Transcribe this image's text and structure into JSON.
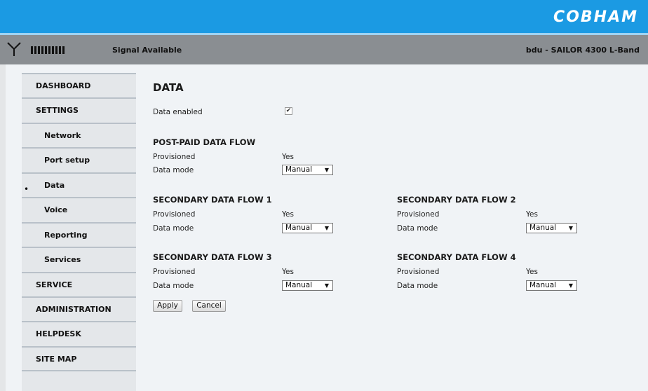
{
  "brand": {
    "logo": "COBHAM"
  },
  "status": {
    "signal_text": "Signal Available",
    "device_text": "bdu - SAILOR 4300 L-Band"
  },
  "sidebar": {
    "items": [
      {
        "label": "DASHBOARD"
      },
      {
        "label": "SETTINGS"
      },
      {
        "label": "Network"
      },
      {
        "label": "Port setup"
      },
      {
        "label": "Data",
        "active": true
      },
      {
        "label": "Voice"
      },
      {
        "label": "Reporting"
      },
      {
        "label": "Services"
      },
      {
        "label": "SERVICE"
      },
      {
        "label": "ADMINISTRATION"
      },
      {
        "label": "HELPDESK"
      },
      {
        "label": "SITE MAP"
      }
    ],
    "active_marker": "•"
  },
  "page": {
    "title": "DATA",
    "data_enabled_label": "Data enabled",
    "data_enabled_checked": true,
    "post_paid": {
      "title": "POST-PAID DATA FLOW",
      "provisioned_label": "Provisioned",
      "provisioned_value": "Yes",
      "mode_label": "Data mode",
      "mode_value": "Manual"
    },
    "secondary1": {
      "title": "SECONDARY DATA FLOW 1",
      "provisioned_label": "Provisioned",
      "provisioned_value": "Yes",
      "mode_label": "Data mode",
      "mode_value": "Manual"
    },
    "secondary2": {
      "title": "SECONDARY DATA FLOW 2",
      "provisioned_label": "Provisioned",
      "provisioned_value": "Yes",
      "mode_label": "Data mode",
      "mode_value": "Manual"
    },
    "secondary3": {
      "title": "SECONDARY DATA FLOW 3",
      "provisioned_label": "Provisioned",
      "provisioned_value": "Yes",
      "mode_label": "Data mode",
      "mode_value": "Manual"
    },
    "secondary4": {
      "title": "SECONDARY DATA FLOW 4",
      "provisioned_label": "Provisioned",
      "provisioned_value": "Yes",
      "mode_label": "Data mode",
      "mode_value": "Manual"
    },
    "apply_label": "Apply",
    "cancel_label": "Cancel"
  },
  "colors": {
    "banner": "#1b9ae3",
    "status_bar": "#8a8e92",
    "sidebar": "#e4e7ea"
  }
}
